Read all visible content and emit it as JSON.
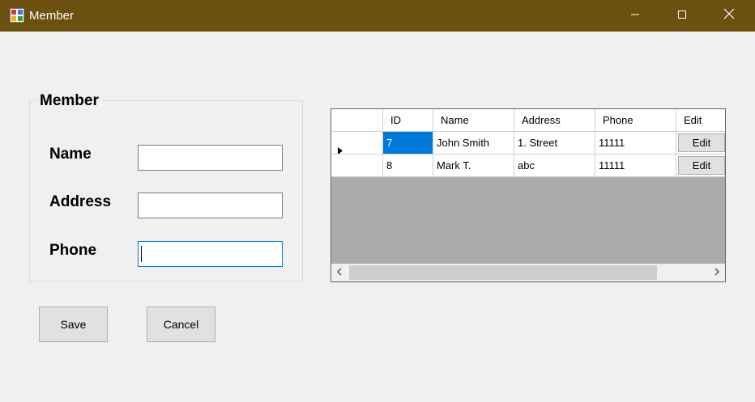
{
  "window": {
    "title": "Member",
    "title_bar_color": "#6b5010"
  },
  "form": {
    "group_title": "Member",
    "fields": [
      {
        "label": "Name",
        "value": ""
      },
      {
        "label": "Address",
        "value": ""
      },
      {
        "label": "Phone",
        "value": ""
      }
    ],
    "focused_field": "Phone"
  },
  "buttons": {
    "save": "Save",
    "cancel": "Cancel"
  },
  "grid": {
    "columns": [
      "ID",
      "Name",
      "Address",
      "Phone",
      "Edit"
    ],
    "rows": [
      {
        "id": "7",
        "name": "John Smith",
        "address": "1. Street",
        "phone": "11111",
        "edit": "Edit",
        "current": true
      },
      {
        "id": "8",
        "name": "Mark T.",
        "address": "abc",
        "phone": "11111",
        "edit": "Edit",
        "current": false
      }
    ],
    "selection_color": "#0078d7"
  },
  "icons": {
    "app": "app-form-icon",
    "minimize": "minimize-icon",
    "maximize": "maximize-icon",
    "close": "close-icon",
    "row_indicator": "row-indicator-arrow-icon",
    "scroll_left": "scroll-left-arrow-icon",
    "scroll_right": "scroll-right-arrow-icon"
  }
}
